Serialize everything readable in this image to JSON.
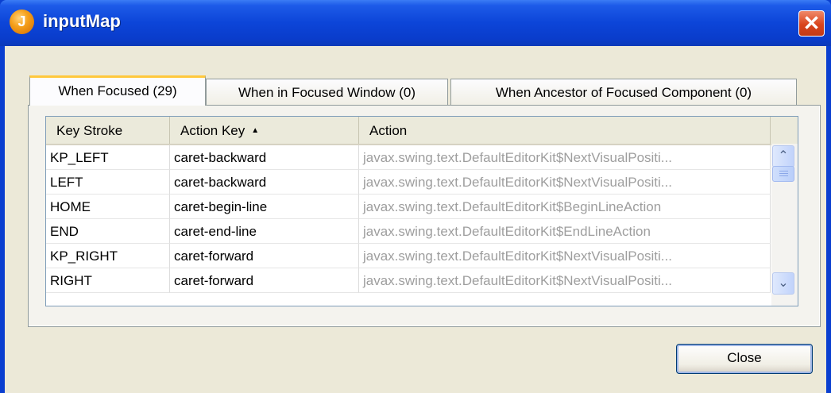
{
  "window": {
    "title": "inputMap",
    "icon": "java-app-icon",
    "close_glyph": "✕"
  },
  "tabs": [
    {
      "label": "When Focused (29)",
      "selected": true
    },
    {
      "label": "When in Focused Window (0)",
      "selected": false
    },
    {
      "label": "When Ancestor of Focused Component (0)",
      "selected": false
    }
  ],
  "table": {
    "columns": [
      "Key Stroke",
      "Action Key",
      "Action"
    ],
    "sort_indicator": "▲",
    "rows": [
      [
        "KP_LEFT",
        "caret-backward",
        "javax.swing.text.DefaultEditorKit$NextVisualPositi..."
      ],
      [
        "LEFT",
        "caret-backward",
        "javax.swing.text.DefaultEditorKit$NextVisualPositi..."
      ],
      [
        "HOME",
        "caret-begin-line",
        "javax.swing.text.DefaultEditorKit$BeginLineAction"
      ],
      [
        "END",
        "caret-end-line",
        "javax.swing.text.DefaultEditorKit$EndLineAction"
      ],
      [
        "KP_RIGHT",
        "caret-forward",
        "javax.swing.text.DefaultEditorKit$NextVisualPositi..."
      ],
      [
        "RIGHT",
        "caret-forward",
        "javax.swing.text.DefaultEditorKit$NextVisualPositi..."
      ]
    ]
  },
  "scrollbar": {
    "up_glyph": "⌃",
    "down_glyph": "⌄"
  },
  "buttons": {
    "close_label": "Close"
  },
  "colors": {
    "title_bar": "#0a3fd0",
    "tab_highlight": "#ffc83c",
    "action_text": "#9e9e9e"
  }
}
